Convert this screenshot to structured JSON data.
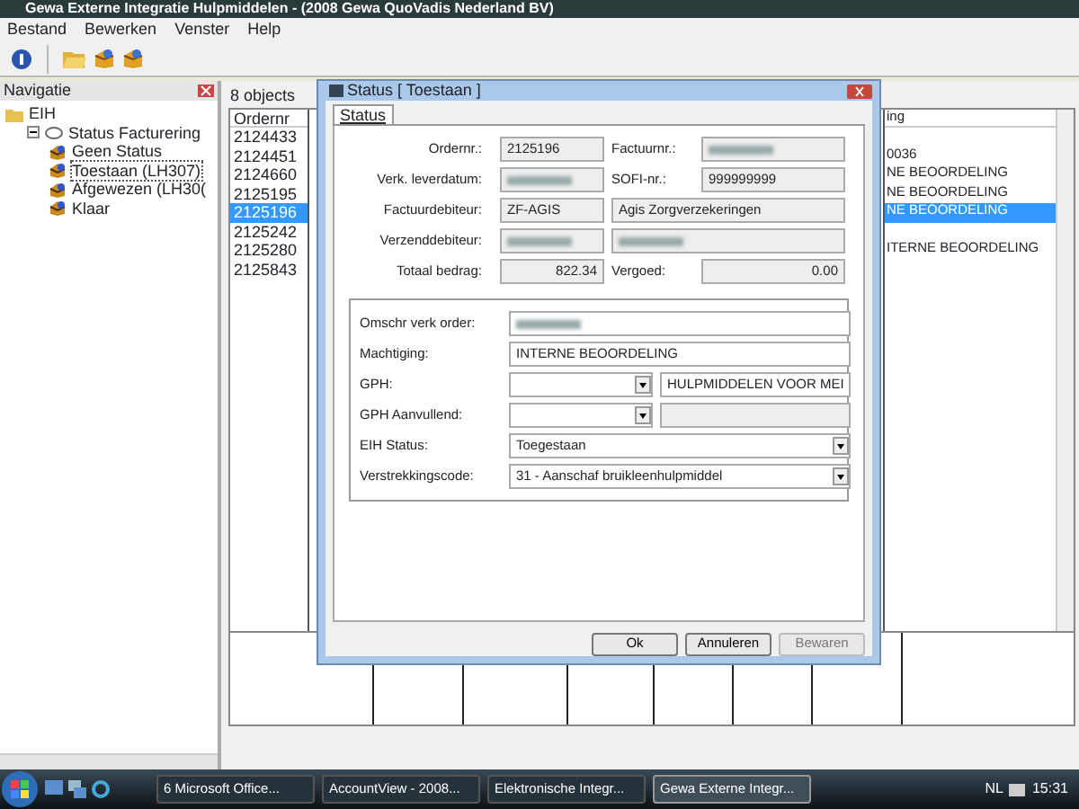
{
  "window": {
    "title": "Gewa Externe Integratie Hulpmiddelen - (2008 Gewa QuoVadis Nederland BV)"
  },
  "menu": [
    "Bestand",
    "Bewerken",
    "Venster",
    "Help"
  ],
  "navigation": {
    "title": "Navigatie",
    "tree": [
      {
        "label": "EIH",
        "kind": "folder",
        "children": [
          {
            "label": "Status Facturering",
            "kind": "status",
            "expanded": true,
            "children": [
              {
                "label": "Geen Status",
                "kind": "box",
                "selected": false
              },
              {
                "label": "Toestaan (LH307)",
                "kind": "box",
                "selected": true
              },
              {
                "label": "Afgewezen (LH30(",
                "kind": "box",
                "selected": false
              },
              {
                "label": "Klaar",
                "kind": "box",
                "selected": false
              }
            ]
          }
        ]
      }
    ]
  },
  "list": {
    "count": "8 objects",
    "columns": [
      "Ordernr",
      "ing"
    ],
    "rows": [
      {
        "cells": [
          "2124433",
          ""
        ],
        "selected": false
      },
      {
        "cells": [
          "2124451",
          "0036"
        ],
        "selected": false
      },
      {
        "cells": [
          "2124660",
          "NE BEOORDELING"
        ],
        "selected": false
      },
      {
        "cells": [
          "2125195",
          "NE BEOORDELING"
        ],
        "selected": false
      },
      {
        "cells": [
          "2125196",
          "NE BEOORDELING"
        ],
        "selected": true
      },
      {
        "cells": [
          "2125242",
          ""
        ],
        "selected": false
      },
      {
        "cells": [
          "2125280",
          "ITERNE BEOORDELING"
        ],
        "selected": false
      },
      {
        "cells": [
          "2125843",
          ""
        ],
        "selected": false
      }
    ]
  },
  "dialog": {
    "title": "Status [ Toestaan ]",
    "tabs": [
      {
        "label": "Status",
        "selected": true
      }
    ],
    "top_fields": [
      {
        "label": "Ordernr.:",
        "value": "2125196",
        "label2": "Factuurnr.:",
        "blur2": true
      },
      {
        "label": "Verk. leverdatum:",
        "blur": true,
        "label2": "SOFI-nr.:",
        "value2": "999999999"
      },
      {
        "label": "Factuurdebiteur:",
        "value": "ZF-AGIS",
        "value2": "Agis Zorgverzekeringen"
      },
      {
        "label": "Verzenddebiteur:",
        "blur": true,
        "blur2": true
      },
      {
        "label": "Totaal bedrag:",
        "value": "822.34",
        "label2": "Vergoed:",
        "value2": "0.00",
        "numeric": true
      }
    ],
    "fields": [
      {
        "label": "Omschr verk order:",
        "kind": "text",
        "blur": true
      },
      {
        "label": "Machtiging:",
        "kind": "text",
        "value": "INTERNE BEOORDELING"
      },
      {
        "label": "GPH:",
        "kind": "combo-pair",
        "value2": "HULPMIDDELEN VOOR MEI"
      },
      {
        "label": "GPH Aanvullend:",
        "kind": "combo-pair"
      },
      {
        "label": "EIH Status:",
        "kind": "combo",
        "value": "Toegestaan"
      },
      {
        "label": "Verstrekkingscode:",
        "kind": "combo",
        "value": "31 - Aanschaf bruikleenhulpmiddel"
      }
    ],
    "buttons": [
      {
        "label": "Ok",
        "disabled": false
      },
      {
        "label": "Annuleren",
        "disabled": false
      },
      {
        "label": "Bewaren",
        "disabled": true
      }
    ]
  },
  "taskbar": {
    "tasks": [
      {
        "label": "6 Microsoft Office...",
        "selected": false
      },
      {
        "label": "AccountView - 2008...",
        "selected": false
      },
      {
        "label": "Elektronische Integr...",
        "selected": false
      },
      {
        "label": "Gewa Externe Integr...",
        "selected": true
      }
    ],
    "language": "NL",
    "clock": "15:31"
  }
}
